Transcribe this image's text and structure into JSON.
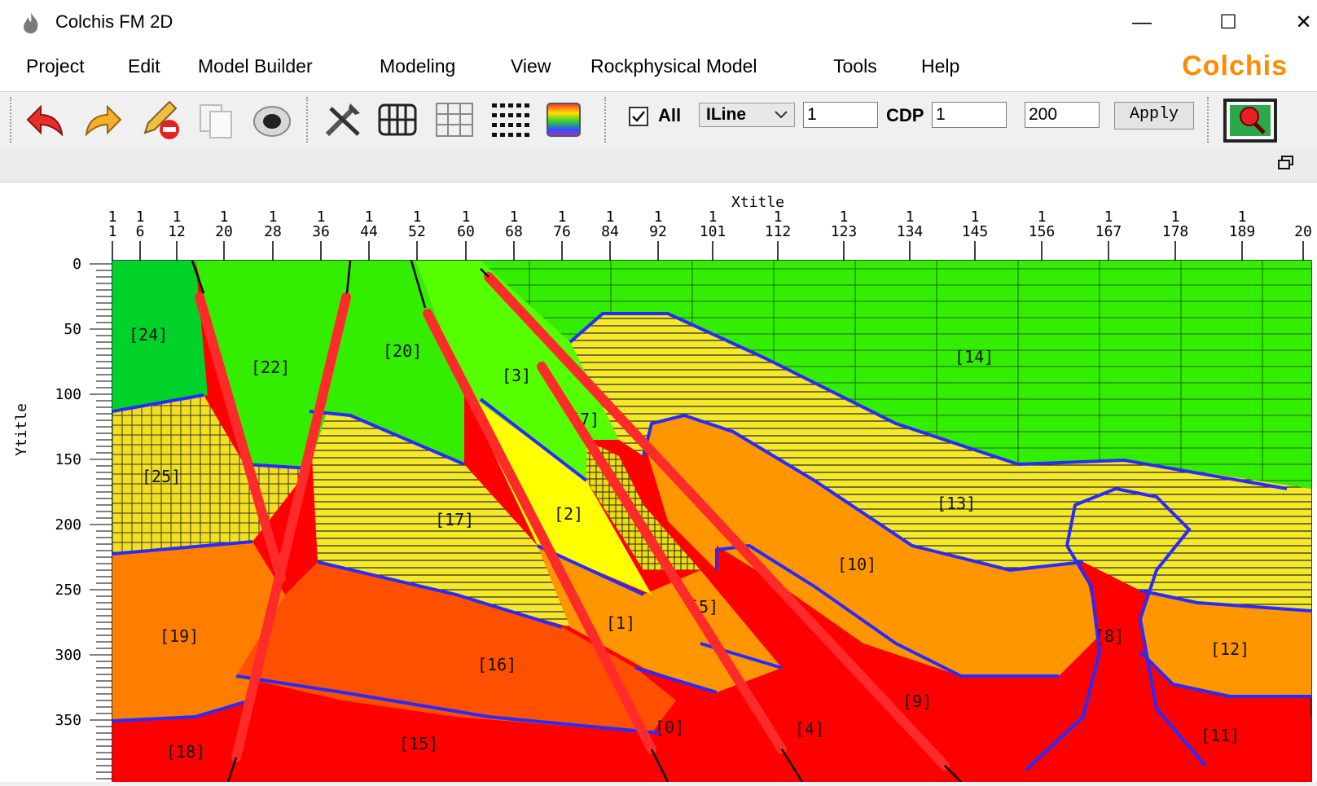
{
  "window": {
    "title": "Colchis FM 2D",
    "minimize": "—",
    "maximize": "☐",
    "close": "✕"
  },
  "menu": {
    "items": [
      "Project",
      "Edit",
      "Model Builder",
      "Modeling",
      "View",
      "Rockphysical Model",
      "Tools",
      "Help"
    ],
    "brand": "Colchis"
  },
  "toolbar": {
    "all_label": "All",
    "all_checked": true,
    "line_type": "ILine",
    "iline_value": "1",
    "cdp_label": "CDP",
    "cdp_value": "1",
    "range_value": "200",
    "apply_label": "Apply",
    "icons": [
      "undo-icon",
      "redo-icon",
      "edit-delete-icon",
      "copy-icon",
      "record-icon",
      "tools-icon",
      "abacus-icon",
      "grid-icon",
      "dots-grid-icon",
      "colormap-icon",
      "zoom-select-icon"
    ]
  },
  "plot": {
    "x_title": "Xtitle",
    "y_title": "Ytitle",
    "x_ticks_top": [
      "1",
      "1",
      "1",
      "1",
      "1",
      "1",
      "1",
      "1",
      "1",
      "1",
      "1",
      "1",
      "1",
      "1",
      "1",
      "1",
      "1",
      "1",
      "1",
      "1",
      "1",
      "1"
    ],
    "x_ticks": [
      "1",
      "6",
      "12",
      "20",
      "28",
      "36",
      "44",
      "52",
      "60",
      "68",
      "76",
      "84",
      "92",
      "101",
      "112",
      "123",
      "134",
      "145",
      "156",
      "167",
      "178",
      "189",
      "20"
    ],
    "y_ticks": [
      "0",
      "50",
      "100",
      "150",
      "200",
      "250",
      "300",
      "350"
    ],
    "region_labels": [
      "[24]",
      "[22]",
      "[20]",
      "[3]",
      "[14]",
      "[25]",
      "[7]",
      "[17]",
      "[2]",
      "[13]",
      "[10]",
      "[19]",
      "[1]",
      "[5]",
      "[16]",
      "[8]",
      "[12]",
      "[9]",
      "[0]",
      "[4]",
      "[11]",
      "[18]",
      "[15]"
    ],
    "colors": {
      "green_dark": "#00d22a",
      "green": "#33ee00",
      "green_light": "#55ff00",
      "yellow": "#ffff00",
      "yellow_hatched": "#f2e020",
      "orange": "#ff9600",
      "orange_red": "#ff5000",
      "red": "#ff0000",
      "boundary": "#2a2aff",
      "fault": "#ff2020"
    }
  }
}
